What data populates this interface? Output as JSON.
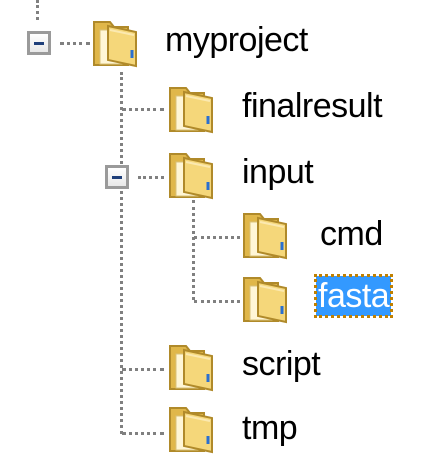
{
  "tree": {
    "root": {
      "label": "myproject",
      "expanded": true,
      "children": [
        {
          "label": "finalresult"
        },
        {
          "label": "input",
          "expanded": true,
          "children": [
            {
              "label": "cmd"
            },
            {
              "label": "fasta",
              "selected": true
            }
          ]
        },
        {
          "label": "script"
        },
        {
          "label": "tmp"
        }
      ]
    }
  },
  "colors": {
    "selection_bg": "#3399ff",
    "selection_text": "#ffffff",
    "folder_fill": "#f5d77a",
    "connector": "#808080"
  },
  "icons": {
    "folder": "folder-icon",
    "collapse": "minus-icon"
  }
}
